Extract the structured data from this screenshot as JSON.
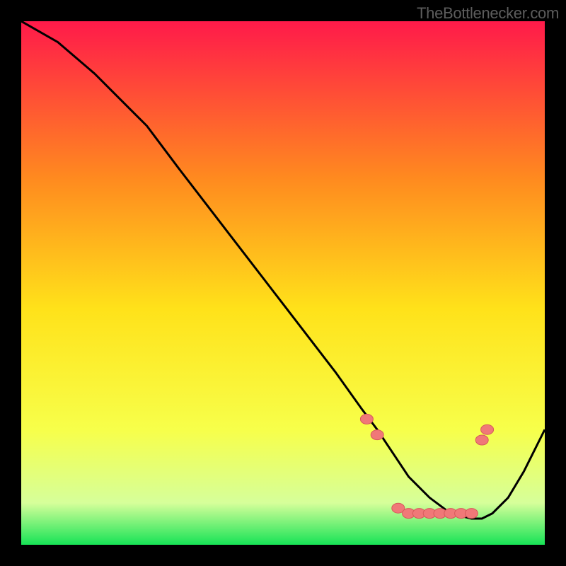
{
  "attribution": "TheBottlenecker.com",
  "colors": {
    "frame": "#000000",
    "gradient_top": "#ff1a4a",
    "gradient_mid_upper": "#ff8a1f",
    "gradient_mid": "#ffe21a",
    "gradient_mid_lower": "#f7ff4a",
    "gradient_low": "#d6ff9a",
    "gradient_bottom": "#17e356",
    "curve": "#000000",
    "marker_fill": "#f07878",
    "marker_stroke": "#d65a5a"
  },
  "chart_data": {
    "type": "line",
    "title": "",
    "xlabel": "",
    "ylabel": "",
    "xlim": [
      0,
      100
    ],
    "ylim": [
      0,
      100
    ],
    "series": [
      {
        "name": "curve",
        "x": [
          0,
          7,
          14,
          21,
          24,
          30,
          40,
          50,
          60,
          65,
          68,
          70,
          74,
          78,
          82,
          86,
          88,
          90,
          93,
          96,
          100
        ],
        "y": [
          100,
          96,
          90,
          83,
          80,
          72,
          59,
          46,
          33,
          26,
          22,
          19,
          13,
          9,
          6,
          5,
          5,
          6,
          9,
          14,
          22
        ]
      }
    ],
    "markers": [
      {
        "x": 66,
        "y": 24
      },
      {
        "x": 68,
        "y": 21
      },
      {
        "x": 72,
        "y": 7
      },
      {
        "x": 74,
        "y": 6
      },
      {
        "x": 76,
        "y": 6
      },
      {
        "x": 78,
        "y": 6
      },
      {
        "x": 80,
        "y": 6
      },
      {
        "x": 82,
        "y": 6
      },
      {
        "x": 84,
        "y": 6
      },
      {
        "x": 86,
        "y": 6
      },
      {
        "x": 88,
        "y": 20
      },
      {
        "x": 89,
        "y": 22
      }
    ]
  }
}
